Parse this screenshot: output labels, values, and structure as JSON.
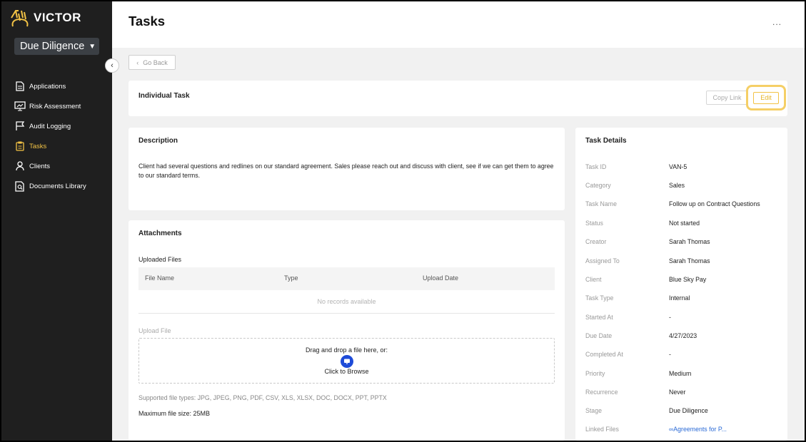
{
  "app": {
    "brand": "VICTOR",
    "module": "Due Diligence"
  },
  "sidebar": {
    "items": [
      {
        "label": "Applications",
        "icon": "document-icon"
      },
      {
        "label": "Risk Assessment",
        "icon": "presentation-chart-icon"
      },
      {
        "label": "Audit Logging",
        "icon": "flag-icon"
      },
      {
        "label": "Tasks",
        "icon": "clipboard-icon",
        "active": true
      },
      {
        "label": "Clients",
        "icon": "user-icon"
      },
      {
        "label": "Documents Library",
        "icon": "document-search-icon"
      }
    ]
  },
  "header": {
    "title": "Tasks",
    "more": "..."
  },
  "go_back": "Go Back",
  "task_head": {
    "title": "Individual Task",
    "copy_link": "Copy Link",
    "edit": "Edit"
  },
  "description": {
    "title": "Description",
    "text": "Client had several questions and redlines on our standard agreement. Sales please reach out and discuss with client, see if we can get them to agree to our standard terms."
  },
  "attachments": {
    "title": "Attachments",
    "uploaded_title": "Uploaded Files",
    "columns": [
      "File Name",
      "Type",
      "Upload Date"
    ],
    "empty": "No records available",
    "upload_label": "Upload File",
    "drop_text": "Drag and drop a file here, or:",
    "browse_text": "Click to Browse",
    "supported": "Supported file types: JPG, JPEG, PNG, PDF, CSV, XLS, XLSX, DOC, DOCX, PPT, PPTX",
    "max_size": "Maximum file size: 25MB"
  },
  "details": {
    "title": "Task Details",
    "rows": [
      {
        "label": "Task ID",
        "value": "VAN-5"
      },
      {
        "label": "Category",
        "value": "Sales"
      },
      {
        "label": "Task Name",
        "value": "Follow up on Contract Questions"
      },
      {
        "label": "Status",
        "value": "Not started"
      },
      {
        "label": "Creator",
        "value": "Sarah Thomas"
      },
      {
        "label": "Assigned To",
        "value": "Sarah Thomas"
      },
      {
        "label": "Client",
        "value": "Blue Sky Pay"
      },
      {
        "label": "Task Type",
        "value": "Internal"
      },
      {
        "label": "Started At",
        "value": "-"
      },
      {
        "label": "Due Date",
        "value": "4/27/2023"
      },
      {
        "label": "Completed At",
        "value": "-"
      },
      {
        "label": "Priority",
        "value": "Medium"
      },
      {
        "label": "Recurrence",
        "value": "Never"
      },
      {
        "label": "Stage",
        "value": "Due Diligence"
      },
      {
        "label": "Linked Files",
        "value": "Agreements for P..."
      }
    ]
  },
  "colors": {
    "accent": "#f2c245",
    "sidebar": "#1f1f1f",
    "link": "#2a6ad6",
    "browse": "#1e4bd8"
  }
}
